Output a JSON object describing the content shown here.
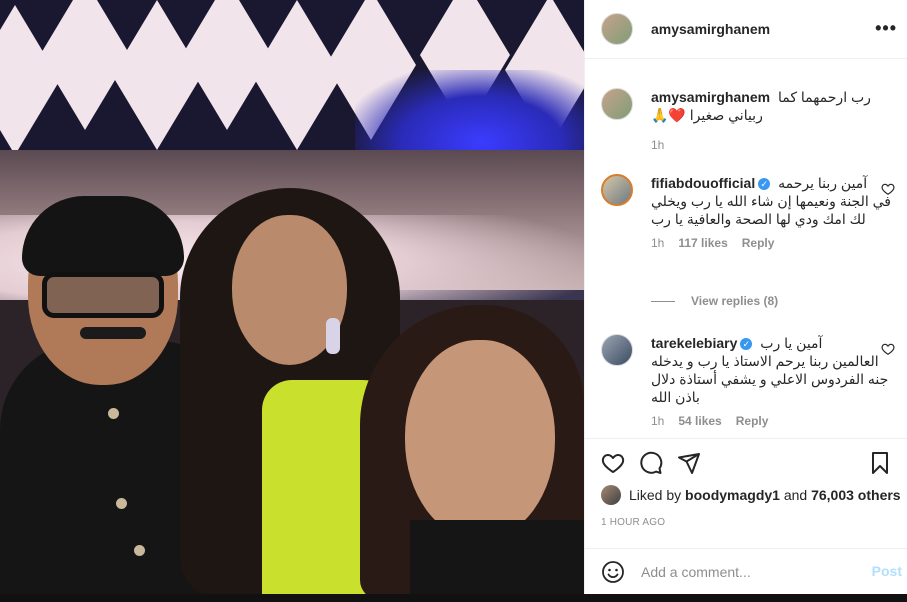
{
  "post": {
    "username": "amysamirghanem",
    "more_label": "•••"
  },
  "caption": {
    "username": "amysamirghanem",
    "line1": "رب ارحمهما كما",
    "line2": "ربياني صغيرا ❤️🙏",
    "time": "1h"
  },
  "comments": [
    {
      "username": "fifiabdouofficial",
      "verified": true,
      "text_first": "آمين ربنا يرحمه",
      "text_rest": "في الجنة ونعيمها إن شاء الله يا رب ويخلي لك امك ودي لها الصحة والعافية يا رب",
      "time": "1h",
      "likes": "117 likes",
      "reply": "Reply"
    },
    {
      "username": "tarekelebiary",
      "verified": true,
      "text_first": "آمين يا رب",
      "text_rest": "العالمين ربنا يرحم الاستاذ يا رب و يدخله جنه الفردوس الاعلي و يشفي أستاذة دلال باذن الله",
      "time": "1h",
      "likes": "54 likes",
      "reply": "Reply"
    }
  ],
  "view_replies": "View replies (8)",
  "likes": {
    "prefix": "Liked by",
    "user": "boodymagdy1",
    "middle": "and",
    "others": "76,003 others"
  },
  "timestamp": "1 HOUR AGO",
  "add_comment": {
    "placeholder": "Add a comment...",
    "post_label": "Post"
  },
  "icons": {
    "like": "heart-icon",
    "comment": "comment-icon",
    "share": "share-icon",
    "save": "bookmark-icon",
    "emoji": "emoji-icon",
    "more": "more-icon"
  },
  "colors": {
    "verified": "#3897f0",
    "post_disabled": "#b2dffc",
    "muted": "#8e8e8e"
  }
}
